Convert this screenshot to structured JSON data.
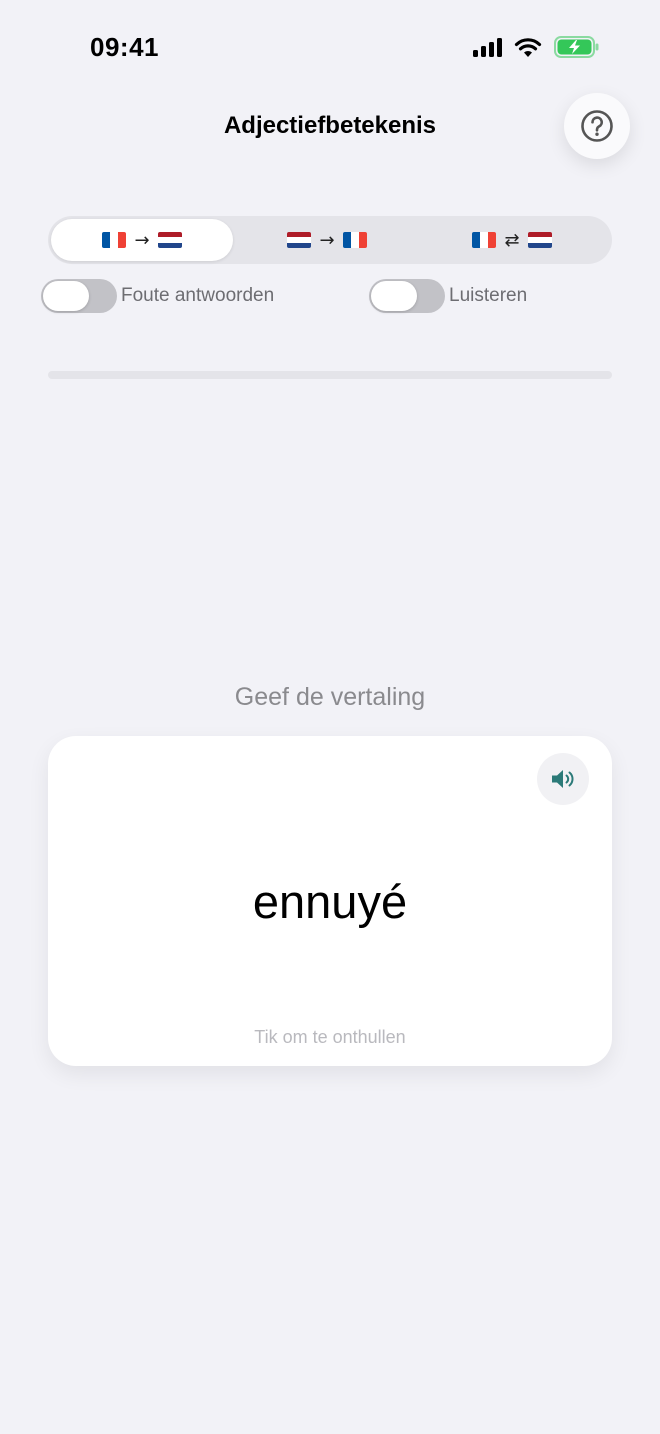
{
  "status_bar": {
    "time": "09:41",
    "icons": [
      "cellular-signal-icon",
      "wifi-icon",
      "battery-charging-icon"
    ],
    "battery_color": "#34c759"
  },
  "header": {
    "title": "Adjectiefbetekenis",
    "help_icon": "question-circle-icon"
  },
  "direction_selector": {
    "selected_index": 0,
    "segments": [
      {
        "from": "fr-flag-icon",
        "arrow": "→",
        "to": "nl-flag-icon"
      },
      {
        "from": "nl-flag-icon",
        "arrow": "→",
        "to": "fr-flag-icon"
      },
      {
        "from": "fr-flag-icon",
        "arrow": "⇄",
        "to": "nl-flag-icon"
      }
    ]
  },
  "toggles": {
    "wrong_answers": {
      "label": "Foute antwoorden",
      "on": false
    },
    "listen": {
      "label": "Luisteren",
      "on": false
    }
  },
  "progress": {
    "fraction": 0,
    "track_color": "#e4e4e9"
  },
  "quiz": {
    "prompt": "Geef de vertaling",
    "word": "ennuyé",
    "hint": "Tik om te onthullen",
    "speaker_icon": "speaker-volume-icon",
    "speaker_color": "#2b7a78"
  }
}
